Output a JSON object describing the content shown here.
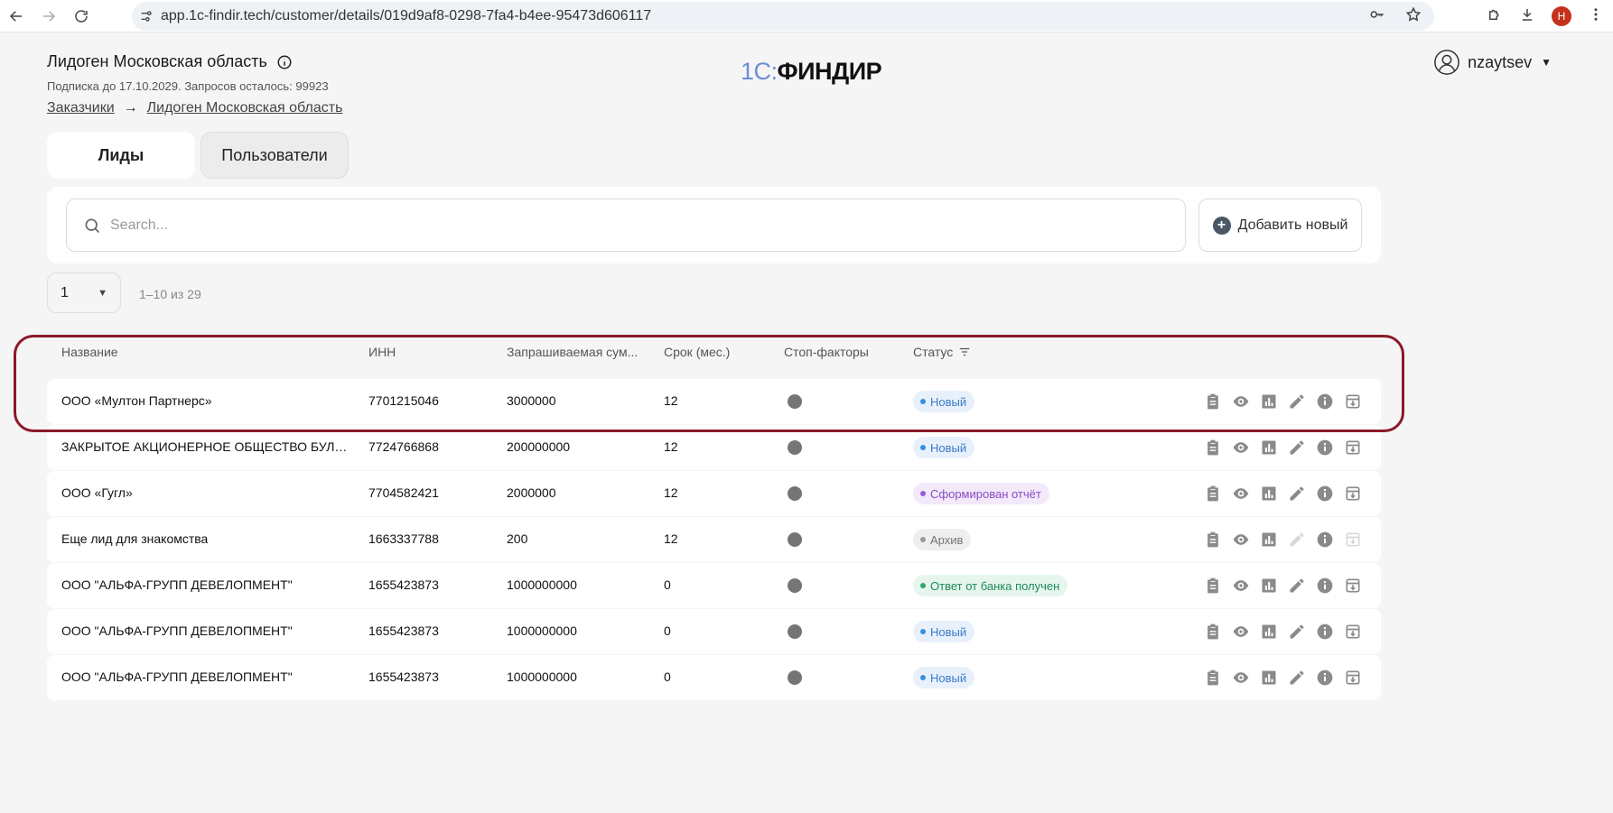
{
  "browser": {
    "url": "app.1c-findir.tech/customer/details/019d9af8-0298-7fa4-b4ee-95473d606117",
    "profile_initial": "Н"
  },
  "header": {
    "customer_name": "Лидоген Московская область",
    "subscription": "Подписка до 17.10.2029. Запросов осталось: 99923",
    "logo_prefix": "1С:",
    "logo_name": "ФИНДИР",
    "username": "nzaytsev"
  },
  "breadcrumb": {
    "root": "Заказчики",
    "separator": "→",
    "current": "Лидоген Московская область"
  },
  "tabs": [
    {
      "label": "Лиды",
      "active": true
    },
    {
      "label": "Пользователи",
      "active": false
    }
  ],
  "search": {
    "placeholder": "Search...",
    "add_label": "Добавить новый"
  },
  "pagination": {
    "page": "1",
    "range": "1–10 из 29"
  },
  "table": {
    "columns": {
      "name": "Название",
      "inn": "ИНН",
      "amount": "Запрашиваемая сум...",
      "term": "Срок (мес.)",
      "stop": "Стоп-факторы",
      "status": "Статус"
    },
    "rows": [
      {
        "name": "ООО «Мултон Партнерс»",
        "inn": "7701215046",
        "amount": "3000000",
        "term": "12",
        "status": "Новый",
        "status_type": "new",
        "edit_enabled": true
      },
      {
        "name": "ЗАКРЫТОЕ АКЦИОНЕРНОЕ ОБЩЕСТВО БУЛОЧ...",
        "inn": "7724766868",
        "amount": "200000000",
        "term": "12",
        "status": "Новый",
        "status_type": "new",
        "edit_enabled": true
      },
      {
        "name": "ООО «Гугл»",
        "inn": "7704582421",
        "amount": "2000000",
        "term": "12",
        "status": "Сформирован отчёт",
        "status_type": "report",
        "edit_enabled": true
      },
      {
        "name": "Еще лид для знакомства",
        "inn": "1663337788",
        "amount": "200",
        "term": "12",
        "status": "Архив",
        "status_type": "archive",
        "edit_enabled": false
      },
      {
        "name": "ООО \"АЛЬФА-ГРУПП ДЕВЕЛОПМЕНТ\"",
        "inn": "1655423873",
        "amount": "1000000000",
        "term": "0",
        "status": "Ответ от банка получен",
        "status_type": "bank",
        "edit_enabled": true
      },
      {
        "name": "ООО \"АЛЬФА-ГРУПП ДЕВЕЛОПМЕНТ\"",
        "inn": "1655423873",
        "amount": "1000000000",
        "term": "0",
        "status": "Новый",
        "status_type": "new",
        "edit_enabled": true
      },
      {
        "name": "ООО \"АЛЬФА-ГРУПП ДЕВЕЛОПМЕНТ\"",
        "inn": "1655423873",
        "amount": "1000000000",
        "term": "0",
        "status": "Новый",
        "status_type": "new",
        "edit_enabled": true
      }
    ]
  },
  "colors": {
    "highlight": "#8b1a28",
    "logo_accent": "#6b8fd6",
    "status_new": "#3a7bc8",
    "status_report": "#8a4cc2",
    "status_bank": "#1f8a57"
  }
}
